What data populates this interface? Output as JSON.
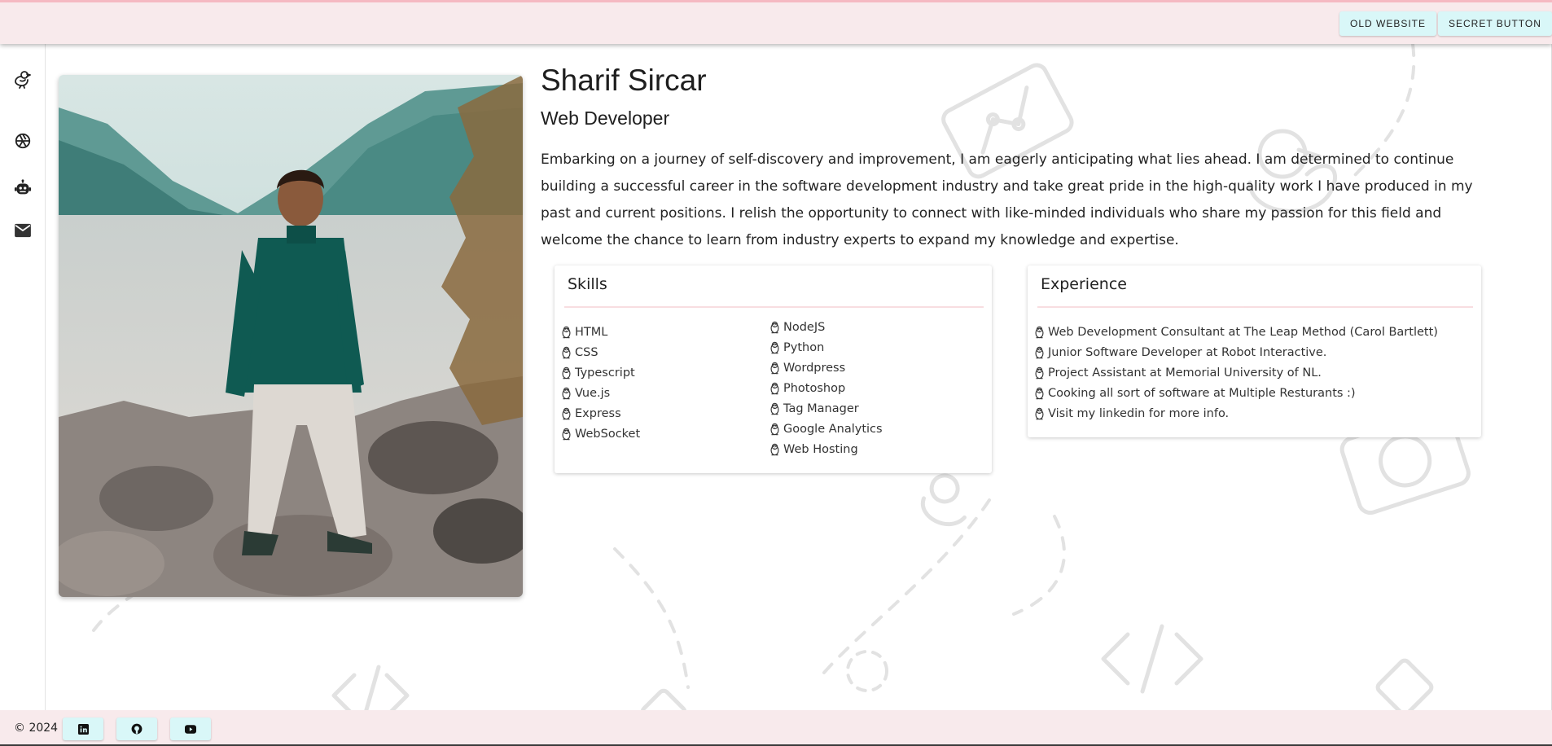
{
  "header": {
    "old_website_label": "OLD WEBSITE",
    "secret_button_label": "SECRET BUTTON"
  },
  "sidebar": {
    "icons": [
      "bird-icon",
      "camera-aperture-icon",
      "robot-icon",
      "mail-icon"
    ]
  },
  "profile": {
    "name": "Sharif Sircar",
    "title": "Web Developer",
    "bio": "Embarking on a journey of self-discovery and improvement, I am eagerly anticipating what lies ahead. I am determined to continue building a successful career in the software development industry and take great pride in the high-quality work I have produced in my past and current positions. I relish the opportunity to connect with like-minded individuals who share my passion for this field and welcome the chance to learn from industry experts to expand my knowledge and expertise."
  },
  "skills": {
    "heading": "Skills",
    "left": [
      "HTML",
      "CSS",
      "Typescript",
      "Vue.js",
      "Express",
      "WebSocket"
    ],
    "right": [
      "NodeJS",
      "Python",
      "Wordpress",
      "Photoshop",
      "Tag Manager",
      "Google Analytics",
      "Web Hosting"
    ]
  },
  "experience": {
    "heading": "Experience",
    "items": [
      "Web Development Consultant at The Leap Method (Carol Bartlett)",
      "Junior Software Developer at Robot Interactive.",
      "Project Assistant at Memorial University of NL.",
      "Cooking all sort of software at Multiple Resturants :)",
      "Visit my linkedin for more info."
    ]
  },
  "footer": {
    "copyright": "© 2024",
    "social_icons": [
      "linkedin-icon",
      "github-icon",
      "youtube-icon"
    ]
  },
  "colors": {
    "bar_background": "#f8eaec",
    "button_background": "#d9f7f8",
    "accent_rule": "#f8dde1"
  }
}
